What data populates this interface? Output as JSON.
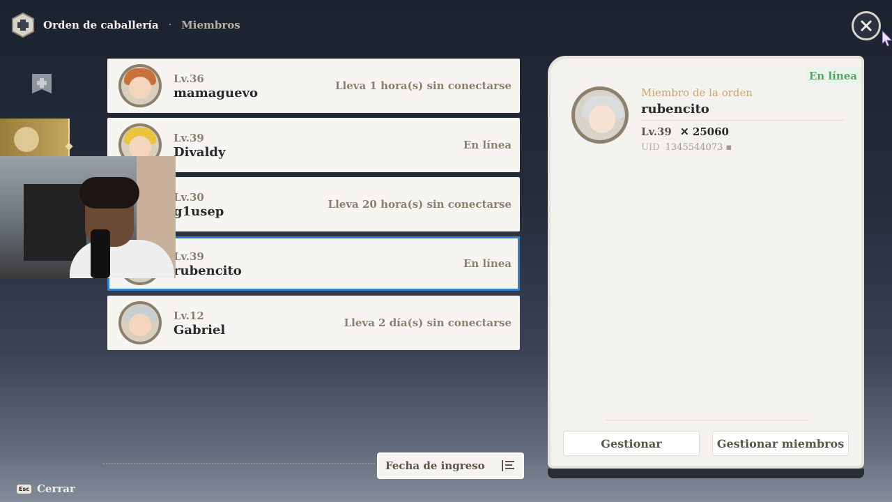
{
  "header": {
    "title": "Orden de caballería",
    "separator": "·",
    "subtitle": "Miembros"
  },
  "members": [
    {
      "level": "Lv.36",
      "name": "mamaguevo",
      "status": "Lleva 1 hora(s) sin conectarse",
      "hair_color": "#c9713a",
      "selected": false
    },
    {
      "level": "Lv.39",
      "name": "Divaldy",
      "status": "En línea",
      "hair_color": "#e8c53c",
      "selected": false
    },
    {
      "level": "Lv.30",
      "name": "g1usep",
      "status": "Lleva 20 hora(s) sin conectarse",
      "hair_color": "#7a5a3c",
      "selected": false
    },
    {
      "level": "Lv.39",
      "name": "rubencito",
      "status": "En línea",
      "hair_color": "#d9d9d9",
      "selected": true
    },
    {
      "level": "Lv.12",
      "name": "Gabriel",
      "status": "Lleva 2 día(s) sin conectarse",
      "hair_color": "#c8cfd3",
      "selected": false
    }
  ],
  "detail": {
    "online": "En línea",
    "role": "Miembro de la orden",
    "name": "rubencito",
    "level": "Lv.39",
    "power": "25060",
    "uid_label": "UID",
    "uid": "1345544073",
    "button_manage": "Gestionar",
    "button_manage_members": "Gestionar miembros"
  },
  "sort": {
    "label": "Fecha de ingreso"
  },
  "footer": {
    "esc_key": "Esc",
    "close_label": "Cerrar"
  },
  "colors": {
    "accent_selected": "#2a7fd6",
    "online_green": "#4ea864",
    "gold": "#c9a56a"
  }
}
